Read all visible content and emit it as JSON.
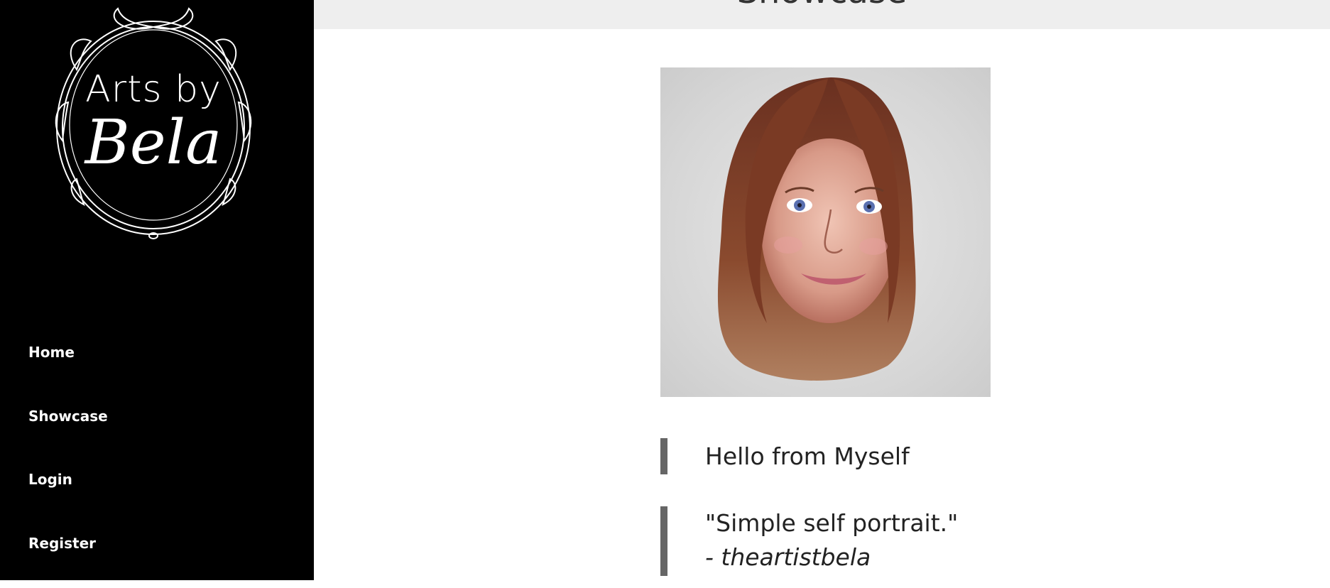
{
  "brand": {
    "line1": "Arts by",
    "line2": "Bela"
  },
  "nav": {
    "items": [
      {
        "label": "Home"
      },
      {
        "label": "Showcase"
      },
      {
        "label": "Login"
      },
      {
        "label": "Register"
      }
    ]
  },
  "header": {
    "title": "Showcase"
  },
  "post": {
    "title": "Hello from Myself",
    "quote": "\"Simple self portrait.\"",
    "author": "- theartistbela"
  },
  "colors": {
    "sidebar_bg": "#000000",
    "header_bg": "#eeeeee",
    "quote_border": "#666666"
  }
}
